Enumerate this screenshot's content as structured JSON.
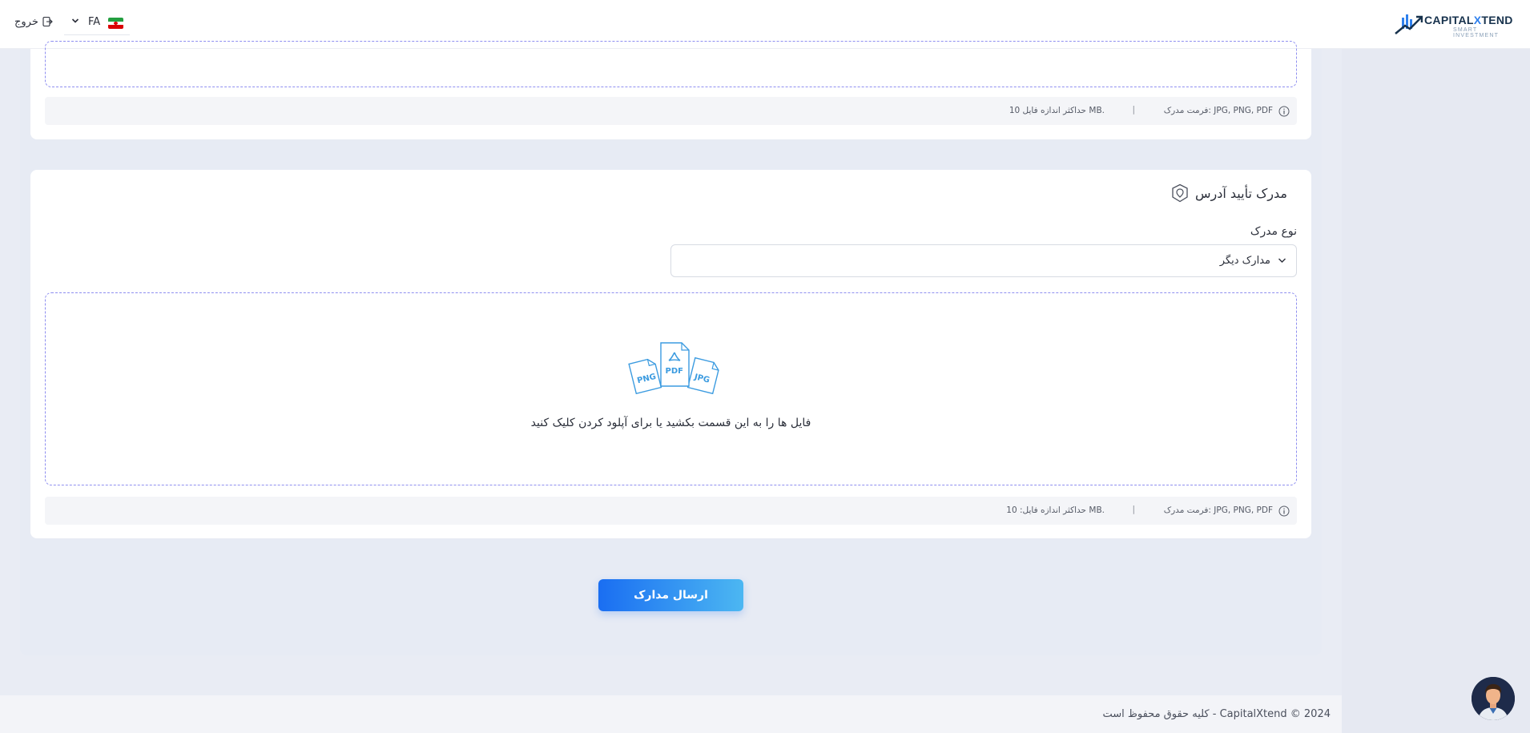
{
  "header": {
    "logo_main": "CAPITAL",
    "logo_x": "X",
    "logo_rest": "TEND",
    "logo_sub": "SMART INVESTMENT",
    "language_code": "FA",
    "logout_label": "خروج"
  },
  "top_section": {
    "format_text": "فرمت مدرک: JPG, PNG, PDF",
    "separator": "|",
    "max_size_text": "حداکثر اندازه فایل 10 MB."
  },
  "address_section": {
    "title": "مدرک تأیید آدرس",
    "doc_type_label": "نوع مدرک",
    "doc_type_value": "مدارک دیگر",
    "file_badges": [
      "PNG",
      "PDF",
      "JPG"
    ],
    "dropzone_hint": "فایل ها را به این قسمت بکشید یا برای آپلود کردن کلیک کنید",
    "format_text": "فرمت مدرک: JPG, PNG, PDF",
    "separator": "|",
    "max_size_text": "حداکثر اندازه فایل: 10 MB."
  },
  "submit_label": "ارسال مدارک",
  "footer": {
    "copyright": "2024 © CapitalXtend - کلیه حقوق محفوظ است"
  },
  "colors": {
    "accent": "#1a6ef2",
    "accent_light": "#4cb7f2",
    "dashed_border": "#8f8ff0",
    "file_icon": "#3b9be0"
  }
}
